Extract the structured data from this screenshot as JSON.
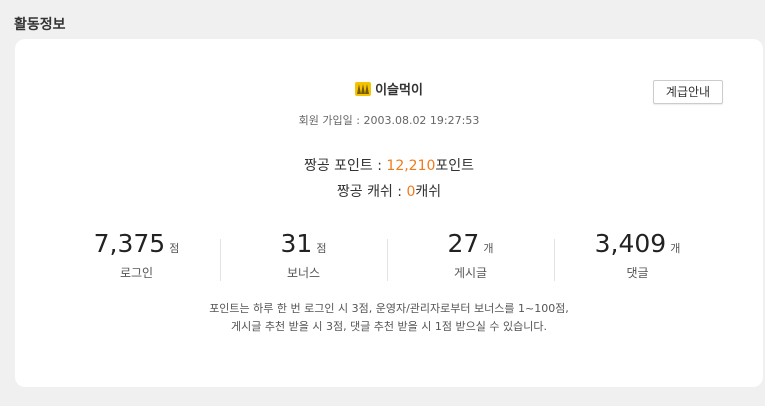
{
  "section": {
    "title": "활동정보"
  },
  "profile": {
    "rank_icon": "rank-badge-icon",
    "nickname": "이슬먹이",
    "guide_button": "계급안내",
    "join_label": "회원 가입일 : ",
    "join_date": "2003.08.02 19:27:53"
  },
  "points": {
    "label": "짱공 포인트 : ",
    "value": "12,210",
    "unit": "포인트"
  },
  "cash": {
    "label": "짱공 캐쉬 : ",
    "value": "0",
    "unit": "캐쉬"
  },
  "stats": [
    {
      "value": "7,375",
      "unit": "점",
      "label": "로그인"
    },
    {
      "value": "31",
      "unit": "점",
      "label": "보너스"
    },
    {
      "value": "27",
      "unit": "개",
      "label": "게시글"
    },
    {
      "value": "3,409",
      "unit": "개",
      "label": "댓글"
    }
  ],
  "notice": {
    "line1": "포인트는 하루 한 번 로그인 시 3점, 운영자/관리자로부터 보너스를 1~100점,",
    "line2": "게시글 추천 받을 시 3점, 댓글 추천 받을 시 1점 받으실 수 있습니다."
  },
  "colors": {
    "accent": "#f07a1e",
    "background": "#f0f0f0",
    "card": "#ffffff"
  }
}
